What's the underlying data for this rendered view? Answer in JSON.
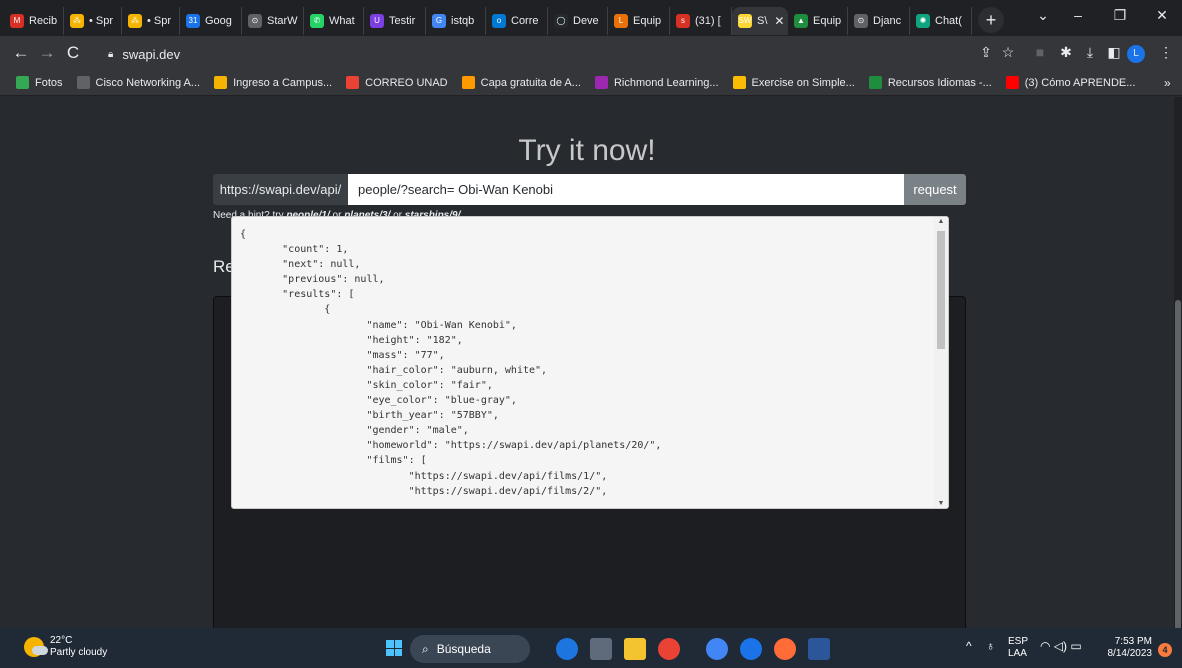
{
  "browser": {
    "tabs": [
      {
        "label": "Recib",
        "color": "#d93025",
        "glyph": "M"
      },
      {
        "label": "• Spr",
        "color": "#f4b400",
        "glyph": "⁂"
      },
      {
        "label": "• Spr",
        "color": "#f4b400",
        "glyph": "⁂"
      },
      {
        "label": "Goog",
        "color": "#1a73e8",
        "glyph": "31"
      },
      {
        "label": "StarW",
        "color": "#5f6368",
        "glyph": "⊙"
      },
      {
        "label": "What",
        "color": "#25d366",
        "glyph": "✆"
      },
      {
        "label": "Testir",
        "color": "#7b3fe4",
        "glyph": "U"
      },
      {
        "label": "istqb",
        "color": "#4285f4",
        "glyph": "G"
      },
      {
        "label": "Corre",
        "color": "#0078d4",
        "glyph": "o"
      },
      {
        "label": "Deve",
        "color": "#24292e",
        "glyph": "◯"
      },
      {
        "label": "Equip",
        "color": "#e8710a",
        "glyph": "L"
      },
      {
        "label": "(31) [",
        "color": "#d93025",
        "glyph": "s"
      },
      {
        "label": "S\\",
        "color": "#fdd835",
        "glyph": "SW",
        "active": true
      },
      {
        "label": "Equip",
        "color": "#1e8e3e",
        "glyph": "▲"
      },
      {
        "label": "Djanc",
        "color": "#5f6368",
        "glyph": "⊙"
      },
      {
        "label": "Chat(",
        "color": "#10a37f",
        "glyph": "✺"
      }
    ],
    "url": "swapi.dev",
    "bookmarks": [
      {
        "label": "Fotos",
        "color": "#34a853"
      },
      {
        "label": "Cisco Networking A...",
        "color": "#5f6368"
      },
      {
        "label": "Ingreso a Campus...",
        "color": "#f4b400"
      },
      {
        "label": "CORREO UNAD",
        "color": "#ea4335"
      },
      {
        "label": "Capa gratuita de A...",
        "color": "#ff9900"
      },
      {
        "label": "Richmond Learning...",
        "color": "#9c27b0"
      },
      {
        "label": "Exercise on Simple...",
        "color": "#fbbc04"
      },
      {
        "label": "Recursos Idiomas -...",
        "color": "#1e8e3e"
      },
      {
        "label": "(3) Cómo APRENDE...",
        "color": "#ff0000"
      }
    ],
    "bookmarks_more": "»",
    "profile_initial": "L"
  },
  "page": {
    "title": "Try it now!",
    "api_base": "https://swapi.dev/api/",
    "query_value": "people/?search= Obi-Wan Kenobi",
    "request_label": "request",
    "hint": {
      "prefix": "Need a hint? try ",
      "link1": "people/1/",
      "sep1": " or ",
      "link2": "planets/3/",
      "sep2": " or ",
      "link3": "starships/9/"
    },
    "result_label": "Result:",
    "result_text": "{\n\t\"count\": 1,\n\t\"next\": null,\n\t\"previous\": null,\n\t\"results\": [\n\t\t{\n\t\t\t\"name\": \"Obi-Wan Kenobi\",\n\t\t\t\"height\": \"182\",\n\t\t\t\"mass\": \"77\",\n\t\t\t\"hair_color\": \"auburn, white\",\n\t\t\t\"skin_color\": \"fair\",\n\t\t\t\"eye_color\": \"blue-gray\",\n\t\t\t\"birth_year\": \"57BBY\",\n\t\t\t\"gender\": \"male\",\n\t\t\t\"homeworld\": \"https://swapi.dev/api/planets/20/\",\n\t\t\t\"films\": [\n\t\t\t\t\"https://swapi.dev/api/films/1/\",\n\t\t\t\t\"https://swapi.dev/api/films/2/\","
  },
  "taskbar": {
    "temperature": "22°C",
    "weather": "Partly cloudy",
    "search_placeholder": "Búsqueda",
    "lang_top": "ESP",
    "lang_bottom": "LAA",
    "time": "7:53 PM",
    "date": "8/14/2023",
    "notification_count": "4"
  }
}
